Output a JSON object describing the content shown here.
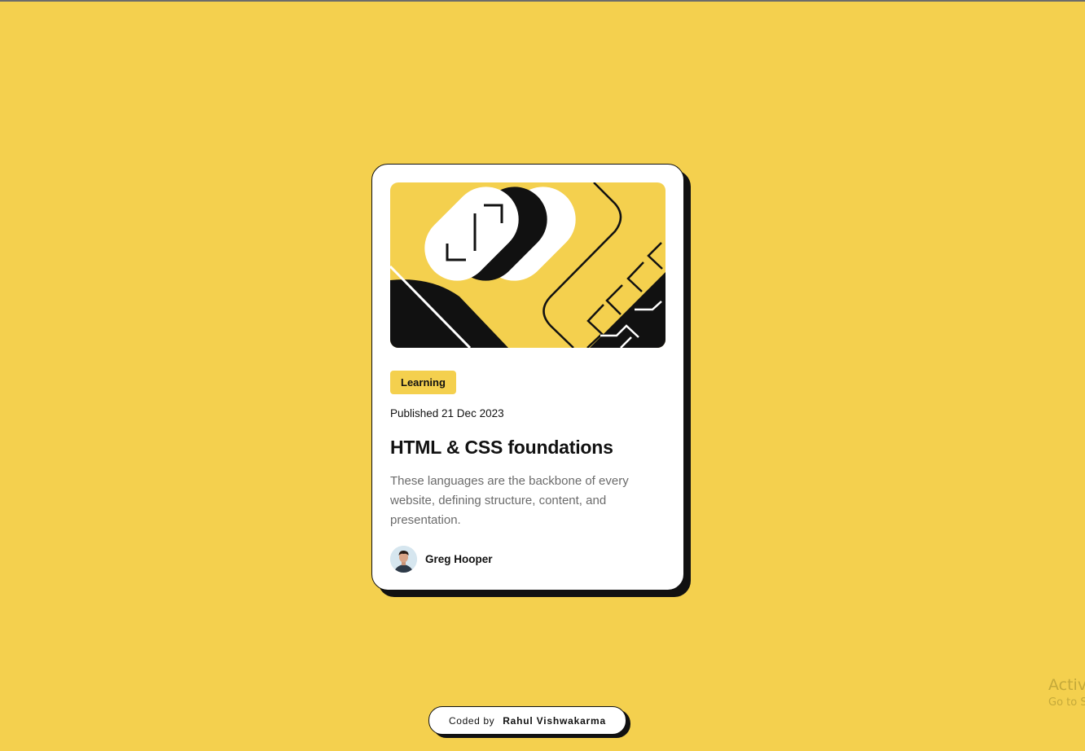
{
  "colors": {
    "background": "#f4d04e",
    "card": "#ffffff",
    "ink": "#111111",
    "muted": "#6b6b6b"
  },
  "card": {
    "illustration": "abstract-geometric-illustration",
    "tag": "Learning",
    "published": "Published 21 Dec 2023",
    "title": "HTML & CSS foundations",
    "description": "These languages are the backbone of every website, defining structure, content, and presentation.",
    "author": {
      "avatar_icon": "avatar-photo",
      "name": "Greg Hooper"
    }
  },
  "footer": {
    "prefix": "Coded by",
    "name": "Rahul Vishwakarma"
  },
  "watermark": {
    "line1": "Activ",
    "line2": "Go to S"
  }
}
